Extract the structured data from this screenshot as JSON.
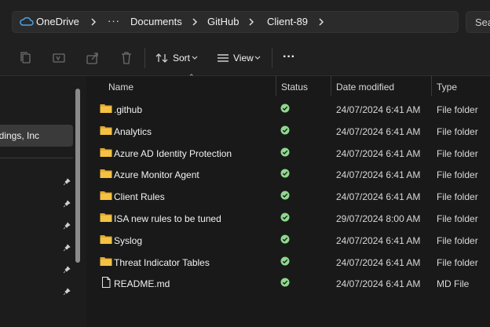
{
  "address": {
    "root": "OneDrive",
    "ellipsis": "···",
    "crumbs": [
      "Documents",
      "GitHub",
      "Client-89"
    ]
  },
  "search": {
    "placeholder": "Search"
  },
  "toolbar": {
    "sort_label": "Sort",
    "view_label": "View",
    "more_label": "···"
  },
  "sidebar": {
    "selected_label": "ldings, Inc"
  },
  "columns": {
    "name": "Name",
    "status": "Status",
    "date": "Date modified",
    "type": "Type"
  },
  "rows": [
    {
      "name": ".github",
      "date": "24/07/2024 6:41 AM",
      "type": "File folder",
      "icon": "folder-icon"
    },
    {
      "name": "Analytics",
      "date": "24/07/2024 6:41 AM",
      "type": "File folder",
      "icon": "folder-icon"
    },
    {
      "name": "Azure AD Identity Protection",
      "date": "24/07/2024 6:41 AM",
      "type": "File folder",
      "icon": "folder-icon"
    },
    {
      "name": "Azure Monitor Agent",
      "date": "24/07/2024 6:41 AM",
      "type": "File folder",
      "icon": "folder-icon"
    },
    {
      "name": "Client Rules",
      "date": "24/07/2024 6:41 AM",
      "type": "File folder",
      "icon": "folder-icon"
    },
    {
      "name": "ISA new rules to be tuned",
      "date": "29/07/2024 8:00 AM",
      "type": "File folder",
      "icon": "folder-icon"
    },
    {
      "name": "Syslog",
      "date": "24/07/2024 6:41 AM",
      "type": "File folder",
      "icon": "folder-icon"
    },
    {
      "name": "Threat Indicator Tables",
      "date": "24/07/2024 6:41 AM",
      "type": "File folder",
      "icon": "folder-icon"
    },
    {
      "name": "README.md",
      "date": "24/07/2024 6:41 AM",
      "type": "MD File",
      "icon": "file-icon"
    }
  ],
  "colors": {
    "folder": "#f4c242",
    "status_synced": "#8fd88f",
    "background": "#191919"
  }
}
